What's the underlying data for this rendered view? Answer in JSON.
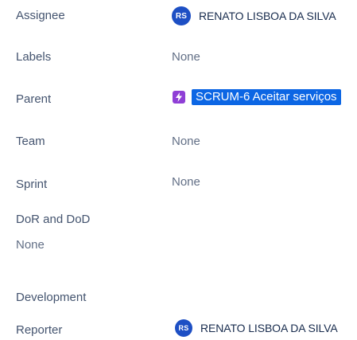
{
  "fields": {
    "assignee": {
      "label": "Assignee",
      "avatar_initials": "RS",
      "name": "RENATO LISBOA DA SILVA"
    },
    "labels": {
      "label": "Labels",
      "value": "None"
    },
    "parent": {
      "label": "Parent",
      "link": "SCRUM-6 Aceitar serviços"
    },
    "team": {
      "label": "Team",
      "value": "None"
    },
    "sprint": {
      "label": "Sprint",
      "value": "None"
    },
    "dor_dod": {
      "label": "DoR and DoD",
      "value": "None"
    },
    "development": {
      "label": "Development"
    },
    "reporter": {
      "label": "Reporter",
      "avatar_initials": "RS",
      "name": "RENATO LISBOA DA SILVA"
    }
  },
  "colors": {
    "avatar_bg": "#1d4fc4",
    "parent_icon_bg": "#8f3fd6",
    "parent_link_bg": "#0c66e4"
  },
  "icons": {
    "parent": "epic-lightning-icon"
  }
}
